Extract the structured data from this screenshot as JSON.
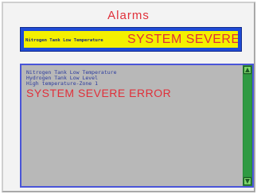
{
  "window": {
    "title": "Alarms"
  },
  "banner": {
    "small_text": "Nitrogen Tank Low Temperature",
    "large_text": "SYSTEM SEVERE E"
  },
  "alarm_list": {
    "items": [
      {
        "text": "Nitrogen Tank Low Temperature",
        "severity": "info"
      },
      {
        "text": "Hydrogen Tank Low Level",
        "severity": "info"
      },
      {
        "text": "High temperature-Zone 1",
        "severity": "info"
      },
      {
        "text": "SYSTEM SEVERE ERROR",
        "severity": "severe"
      }
    ]
  },
  "scrollbar": {
    "up_icon": "triangle-up",
    "down_icon": "triangle-down"
  },
  "colors": {
    "title_red": "#e0303a",
    "banner_blue": "#1f4bd6",
    "banner_yellow": "#f4f000",
    "list_bg": "#b8b8b8",
    "list_text_blue": "#2b3b9e",
    "scroll_green": "#2a8a3a"
  }
}
